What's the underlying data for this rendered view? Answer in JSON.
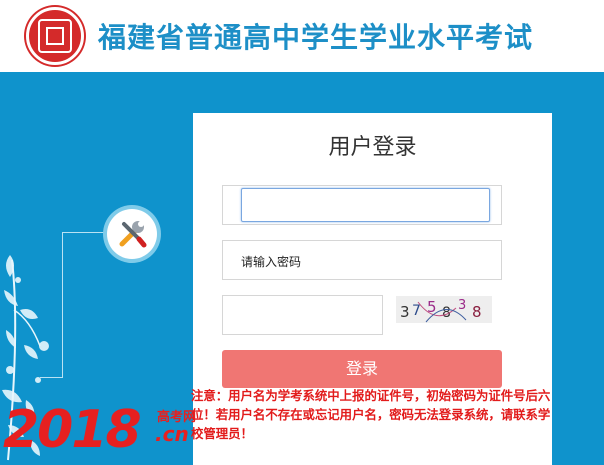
{
  "header": {
    "site_title": "福建省普通高中学生学业水平考试"
  },
  "login": {
    "title": "用户登录",
    "username_value": "",
    "password_placeholder": "请输入密码",
    "captcha_value": "",
    "captcha_text": "375838",
    "submit_label": "登录"
  },
  "notice": "注意：用户名为学考系统中上报的证件号，初始密码为证件号后六位！若用户名不存在或忘记用户名，密码无法登录系统，请联系学校管理员！",
  "watermark": {
    "number": "2018",
    "text_top": "高考网",
    "text_bottom": ".cn"
  },
  "colors": {
    "brand_blue": "#0f93cc",
    "title_blue": "#1d8fc7",
    "logo_red": "#d42a2a",
    "button_red": "#f07673",
    "notice_red": "#e21b1b"
  },
  "icons": {
    "logo": "school-seal-icon",
    "tools": "wrench-screwdriver-icon"
  }
}
